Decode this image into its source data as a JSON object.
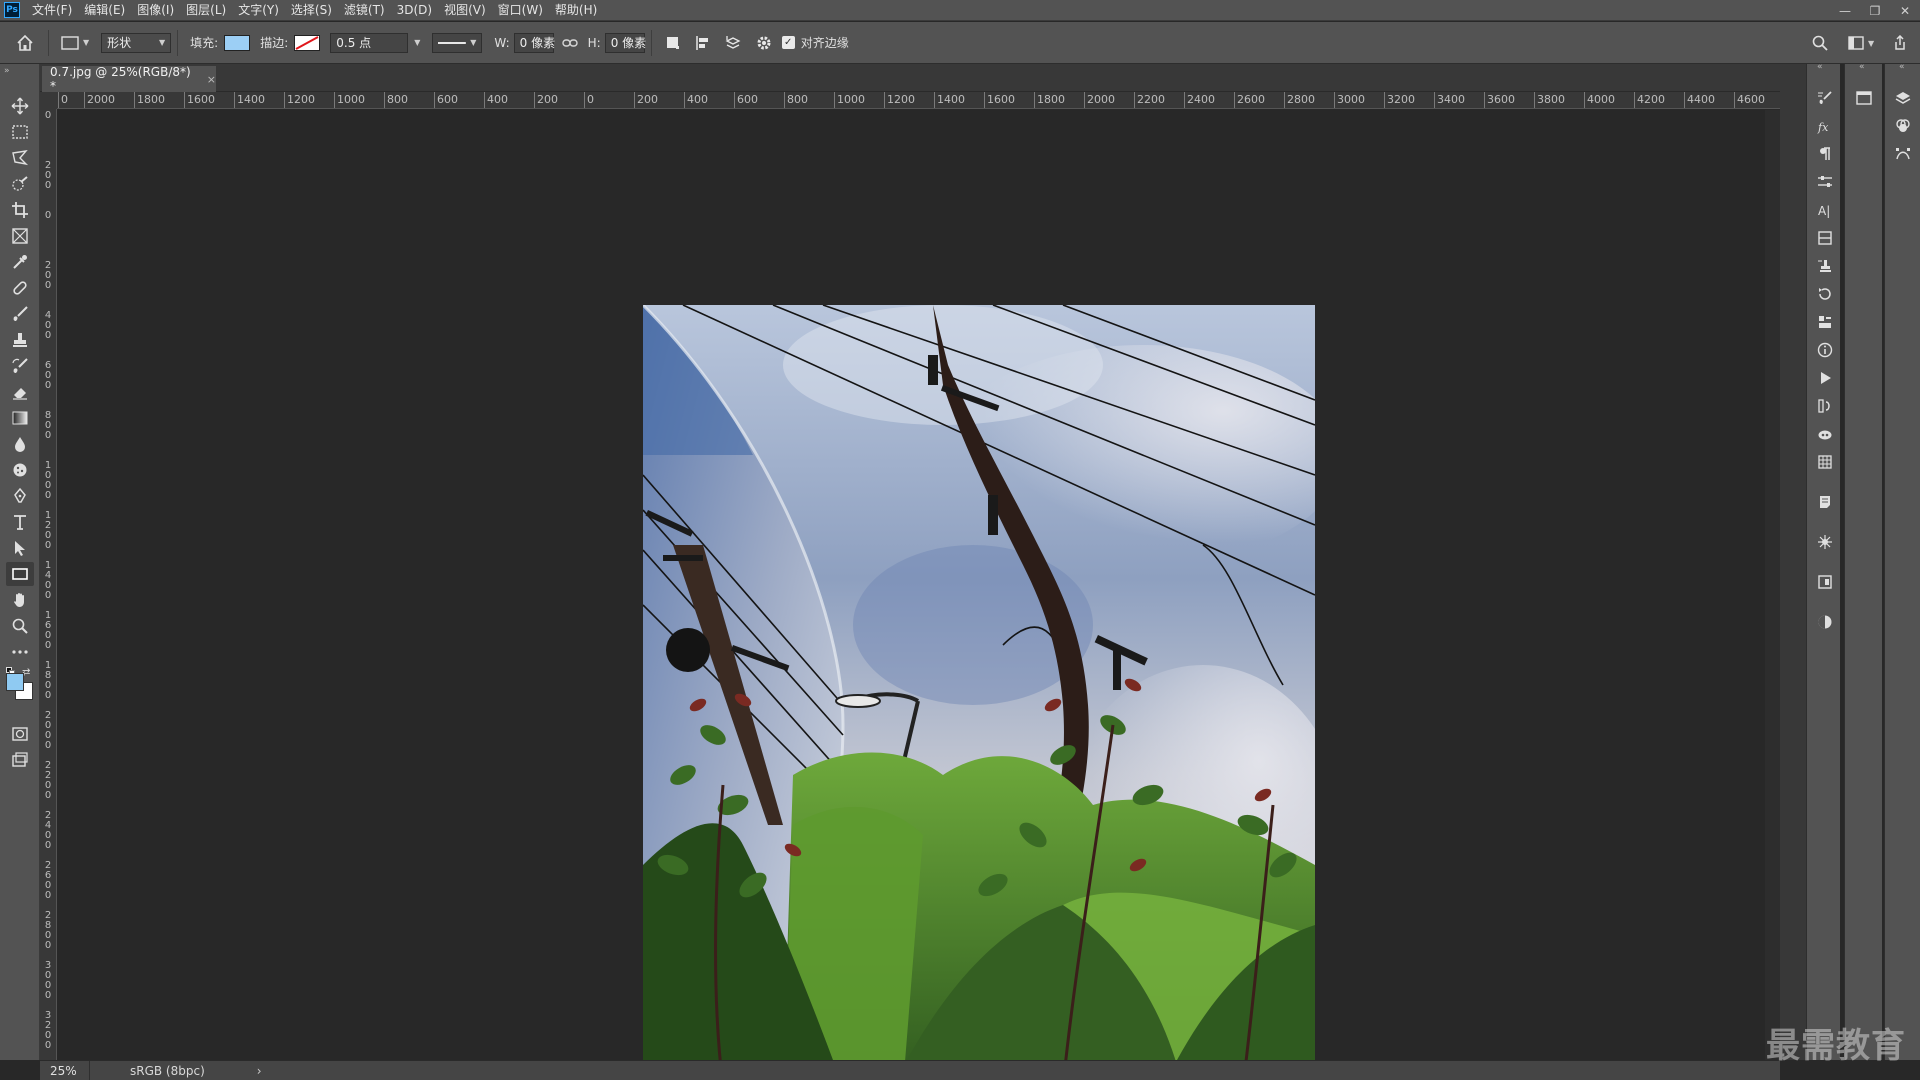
{
  "menubar": {
    "logo": "Ps",
    "items": [
      "文件(F)",
      "编辑(E)",
      "图像(I)",
      "图层(L)",
      "文字(Y)",
      "选择(S)",
      "滤镜(T)",
      "3D(D)",
      "视图(V)",
      "窗口(W)",
      "帮助(H)"
    ],
    "window_controls": [
      "—",
      "❐",
      "✕"
    ]
  },
  "options": {
    "mode_label": "形状",
    "fill_label": "填充:",
    "fill_color": "#9ccff5",
    "stroke_label": "描边:",
    "stroke_width": "0.5 点",
    "w_label": "W:",
    "w_value": "0 像素",
    "h_label": "H:",
    "h_value": "0 像素",
    "align_edges_label": "对齐边缘"
  },
  "document": {
    "tab_title": "0.7.jpg @ 25%(RGB/8*) *",
    "close": "×"
  },
  "ruler_top": [
    "0",
    "2000",
    "1800",
    "1600",
    "1400",
    "1200",
    "1000",
    "800",
    "600",
    "400",
    "200",
    "0",
    "200",
    "400",
    "600",
    "800",
    "1000",
    "1200",
    "1400",
    "1600",
    "1800",
    "2000",
    "2200",
    "2400",
    "2600",
    "2800",
    "3000",
    "3200",
    "3400",
    "3600",
    "3800",
    "4000",
    "4200",
    "4400",
    "4600"
  ],
  "ruler_left": [
    "0",
    "200",
    "0",
    "200",
    "400",
    "600",
    "800",
    "1000",
    "1200",
    "1400",
    "1600",
    "1800",
    "2000",
    "2200",
    "2400",
    "2600",
    "2800",
    "3000",
    "3200"
  ],
  "status": {
    "zoom": "25%",
    "profile": "sRGB (8bpc)",
    "arrow": "›"
  },
  "watermark": "最需教育",
  "colors": {
    "foreground": "#8fcaf2",
    "background": "#ffffff"
  }
}
